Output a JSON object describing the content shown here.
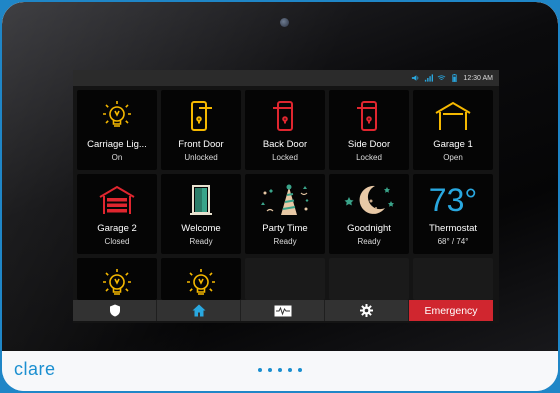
{
  "status": {
    "time": "12:30 AM"
  },
  "tiles": [
    {
      "name": "Carriage Lig...",
      "state": "On",
      "icon": "lightbulb-icon"
    },
    {
      "name": "Front Door",
      "state": "Unlocked",
      "icon": "door-unlocked-icon"
    },
    {
      "name": "Back Door",
      "state": "Locked",
      "icon": "door-locked-icon"
    },
    {
      "name": "Side Door",
      "state": "Locked",
      "icon": "door-locked-icon"
    },
    {
      "name": "Garage 1",
      "state": "Open",
      "icon": "garage-open-icon"
    },
    {
      "name": "Garage 2",
      "state": "Closed",
      "icon": "garage-closed-icon"
    },
    {
      "name": "Welcome",
      "state": "Ready",
      "icon": "welcome-door-icon"
    },
    {
      "name": "Party Time",
      "state": "Ready",
      "icon": "party-hat-icon"
    },
    {
      "name": "Goodnight",
      "state": "Ready",
      "icon": "moon-stars-icon"
    },
    {
      "name": "Thermostat",
      "state": "68° / 74°",
      "value": "73°",
      "icon": "thermostat"
    }
  ],
  "nav": {
    "items": [
      "shield-icon",
      "home-icon",
      "activity-icon",
      "gear-icon"
    ],
    "emergency_label": "Emergency"
  },
  "brand": {
    "logo": "clare"
  },
  "colors": {
    "accent": "#29a8e0",
    "locked": "#e0262f",
    "unlocked": "#f5b800",
    "emergency": "#d0262f"
  }
}
